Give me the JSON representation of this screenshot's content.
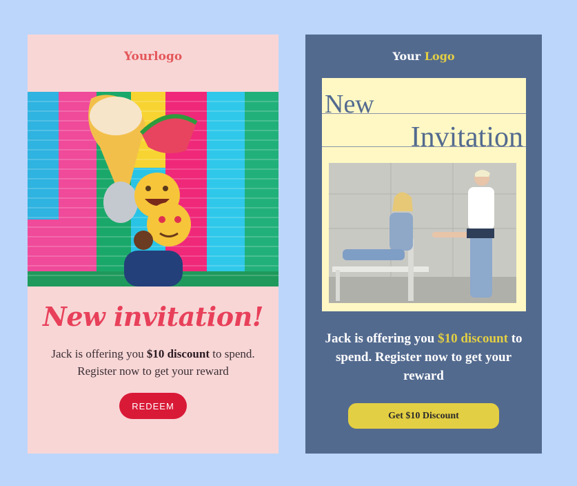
{
  "pink_card": {
    "logo": "Yourlogo",
    "title": "New invitation!",
    "text_pre": "Jack is offering you ",
    "text_bold": "$10 discount",
    "text_post": " to spend. Register now to get your reward",
    "button_label": "REDEEM"
  },
  "blue_card": {
    "logo_word1": "Your",
    "logo_word2": "Logo",
    "title_line1": "New",
    "title_line2": "Invitation",
    "text_pre": "Jack is offering you ",
    "text_highlight": "$10 discount",
    "text_post": " to spend. Register now to get your reward",
    "button_label": "Get $10 Discount"
  },
  "colors": {
    "background": "#bcd6fb",
    "pink_card": "#f8d6d6",
    "blue_card": "#536a8f",
    "accent_red": "#d91a37",
    "accent_yellow": "#e3cf43",
    "panel_yellow": "#fff8c4"
  }
}
